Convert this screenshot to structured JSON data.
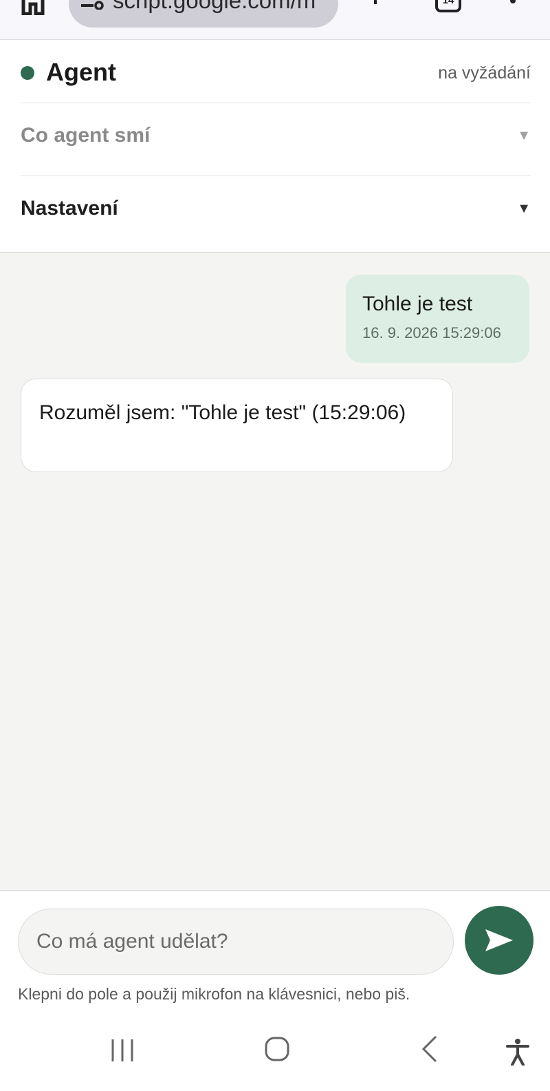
{
  "browser": {
    "url": "script.google.com/m",
    "tab_count": "14"
  },
  "header": {
    "title": "Agent",
    "mode": "na vyžádání",
    "status_color": "#2e6a52"
  },
  "sections": {
    "permissions_label": "Co agent smí",
    "settings_label": "Nastavení",
    "caret": "▼"
  },
  "messages": [
    {
      "role": "user",
      "text": "Tohle je test",
      "timestamp": "16. 9. 2026 15:29:06"
    },
    {
      "role": "agent",
      "text": "Rozuměl jsem: \"Tohle je test\" (15:29:06)"
    }
  ],
  "composer": {
    "placeholder": "Co má agent udělat?",
    "hint": "Klepni do pole a použij mikrofon na klávesnici, nebo piš.",
    "send_color": "#2d6a50"
  },
  "icons": {
    "home": "home-icon",
    "site_settings": "tune-icon",
    "new_tab": "plus-icon",
    "tabs": "tabs-icon",
    "more": "more-vert-icon",
    "send": "send-icon",
    "nav_recents": "recents-icon",
    "nav_home": "home-circle-icon",
    "nav_back": "back-icon",
    "accessibility": "accessibility-icon"
  }
}
